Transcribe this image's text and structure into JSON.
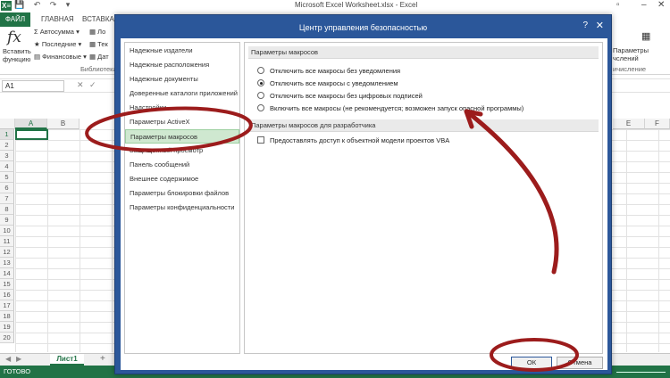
{
  "excel": {
    "title": "Microsoft Excel Worksheet.xlsx - Excel",
    "logo": "X≡",
    "quick_access": "💾 ↶ ↷ ▾",
    "tabs": [
      "ФАЙЛ",
      "ГЛАВНАЯ",
      "ВСТАВКА"
    ],
    "ribbon": {
      "insert_function_line1": "Вставить",
      "insert_function_line2": "функцию",
      "fx": "fx",
      "autosum": "Автосумма",
      "recent": "Последние",
      "financial": "Финансовые",
      "lo": "Ло",
      "te": "Тек",
      "da": "Дат",
      "library_group": "Библиотека",
      "params_line1": "Параметры",
      "params_line2": "чслений",
      "calc_group": "ичисление"
    },
    "name_box": "A1",
    "columns": [
      "A",
      "B"
    ],
    "right_columns": [
      "E",
      "F"
    ],
    "rows": [
      "1",
      "2",
      "3",
      "4",
      "5",
      "6",
      "7",
      "8",
      "9",
      "10",
      "11",
      "12",
      "13",
      "14",
      "15",
      "16",
      "17",
      "18",
      "19",
      "20"
    ],
    "sheet_tab": "Лист1",
    "add_sheet": "+",
    "status": "ГОТОВО"
  },
  "dialog": {
    "title": "Центр управления безопасностью",
    "help": "?",
    "close": "✕",
    "nav": [
      "Надежные издатели",
      "Надежные расположения",
      "Надежные документы",
      "Доверенные каталоги приложений",
      "Надстройки",
      "Параметры ActiveX",
      "Параметры макросов",
      "Защищенный просмотр",
      "Панель сообщений",
      "Внешнее содержимое",
      "Параметры блокировки файлов",
      "Параметры конфиденциальности"
    ],
    "selected_nav": "Параметры макросов",
    "macro_section": "Параметры макросов",
    "options": [
      "Отключить все макросы без уведомления",
      "Отключить все макросы с уведомлением",
      "Отключить все макросы без цифровых подписей",
      "Включить все макросы (не рекомендуется; возможен запуск опасной программы)"
    ],
    "selected_option": 1,
    "dev_section": "Параметры макросов для разработчика",
    "vba_checkbox": "Предоставлять доступ к объектной модели проектов VBA",
    "ok": "ОК",
    "cancel": "Отмена"
  },
  "annotation_color": "#9c1c1c"
}
